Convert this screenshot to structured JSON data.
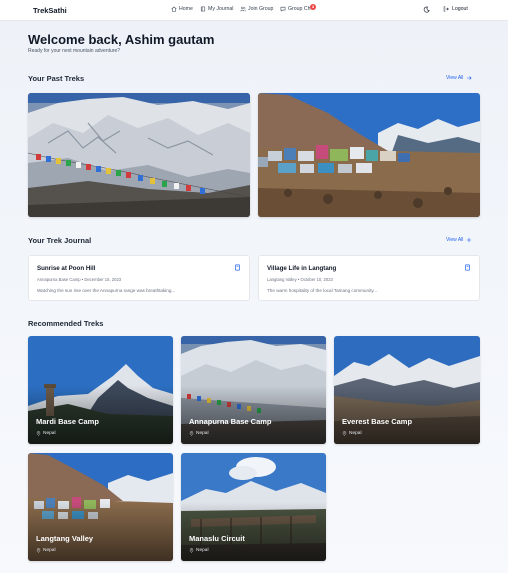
{
  "nav": {
    "brand": "TrekSathi",
    "links": [
      {
        "label": "Home",
        "icon": "home-icon"
      },
      {
        "label": "My Journal",
        "icon": "book-icon"
      },
      {
        "label": "Join Group",
        "icon": "users-icon"
      },
      {
        "label": "Group Ch",
        "icon": "chat-icon"
      }
    ],
    "notification_count": "3",
    "logout_label": "Logout"
  },
  "header": {
    "welcome": "Welcome back, Ashim gautam",
    "subtitle": "Ready for your next mountain adventure?"
  },
  "past_treks": {
    "title": "Your Past Treks",
    "view_all": "View All"
  },
  "journal": {
    "title": "Your Trek Journal",
    "view_all": "View All",
    "entries": [
      {
        "title": "Sunrise at Poon Hill",
        "meta": "Annapurna Base Camp • December 15, 2023",
        "excerpt": "Watching the sun rise over the Annapurna range was breathtaking..."
      },
      {
        "title": "Village Life in Langtang",
        "meta": "Langtang Valley • October 10, 2023",
        "excerpt": "The warm hospitality of the local Tamang community..."
      }
    ]
  },
  "recommended": {
    "title": "Recommended Treks",
    "items": [
      {
        "name": "Mardi Base Camp",
        "location": "Nepal"
      },
      {
        "name": "Annapurna Base Camp",
        "location": "Nepal"
      },
      {
        "name": "Everest Base Camp",
        "location": "Nepal"
      },
      {
        "name": "Langtang Valley",
        "location": "Nepal"
      },
      {
        "name": "Manaslu Circuit",
        "location": "Nepal"
      }
    ]
  },
  "colors": {
    "accent": "#2563eb",
    "notification": "#ef4444",
    "sky": "#2f6fc4"
  }
}
